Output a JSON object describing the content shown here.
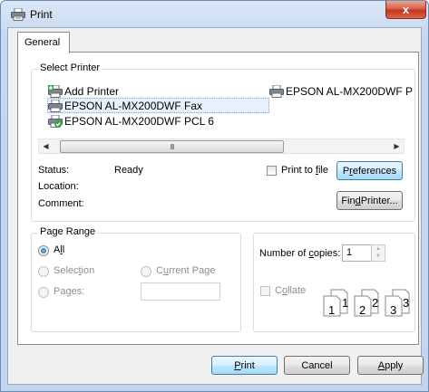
{
  "window": {
    "title": "Print",
    "close_label": "x"
  },
  "tabs": [
    {
      "label": "General"
    }
  ],
  "select_printer": {
    "group_label": "Select Printer",
    "printers": [
      {
        "name": "Add Printer",
        "icon": "add-printer-icon"
      },
      {
        "name": "EPSON AL-MX200DWF P",
        "icon": "printer-icon"
      },
      {
        "name": "EPSON AL-MX200DWF Fax",
        "icon": "fax-printer-icon",
        "selected": true
      },
      {
        "name": "EPSON AL-MX200DWF PCL 6",
        "icon": "default-printer-icon",
        "default": true
      }
    ],
    "status_label": "Status:",
    "status_value": "Ready",
    "location_label": "Location:",
    "comment_label": "Comment:",
    "print_to_file": {
      "pre": "Print to ",
      "key": "f",
      "post": "ile",
      "checked": false
    },
    "preferences": {
      "pre": "P",
      "key": "r",
      "post": "eferences"
    },
    "find_printer": {
      "pre": "Fin",
      "key": "d",
      "post": " Printer..."
    },
    "scroll_grip": "III"
  },
  "page_range": {
    "group_label": "Page Range",
    "all": {
      "pre": "A",
      "key": "l",
      "post": "l",
      "selected": true
    },
    "selection": {
      "pre": "Selec",
      "key": "t",
      "post": "ion",
      "enabled": false
    },
    "current_page": {
      "pre": "C",
      "key": "u",
      "post": "rrent Page",
      "enabled": false
    },
    "pages": {
      "pre": "Pa",
      "key": "g",
      "post": "es:",
      "enabled": false,
      "value": ""
    }
  },
  "copies": {
    "number_label": {
      "pre": "Number of ",
      "key": "c",
      "post": "opies:"
    },
    "value": "1",
    "collate": {
      "pre": "C",
      "key": "o",
      "post": "llate",
      "checked": false,
      "enabled": false
    },
    "collate_pages": [
      "1",
      "1",
      "2",
      "2",
      "3",
      "3"
    ]
  },
  "footer": {
    "print": {
      "pre": "",
      "key": "P",
      "post": "rint"
    },
    "cancel": {
      "label": "Cancel"
    },
    "apply": {
      "pre": "",
      "key": "A",
      "post": "pply"
    }
  },
  "colors": {
    "accent": "#3c7fb1",
    "close": "#c4341a",
    "selection": "#e8f1fb"
  }
}
